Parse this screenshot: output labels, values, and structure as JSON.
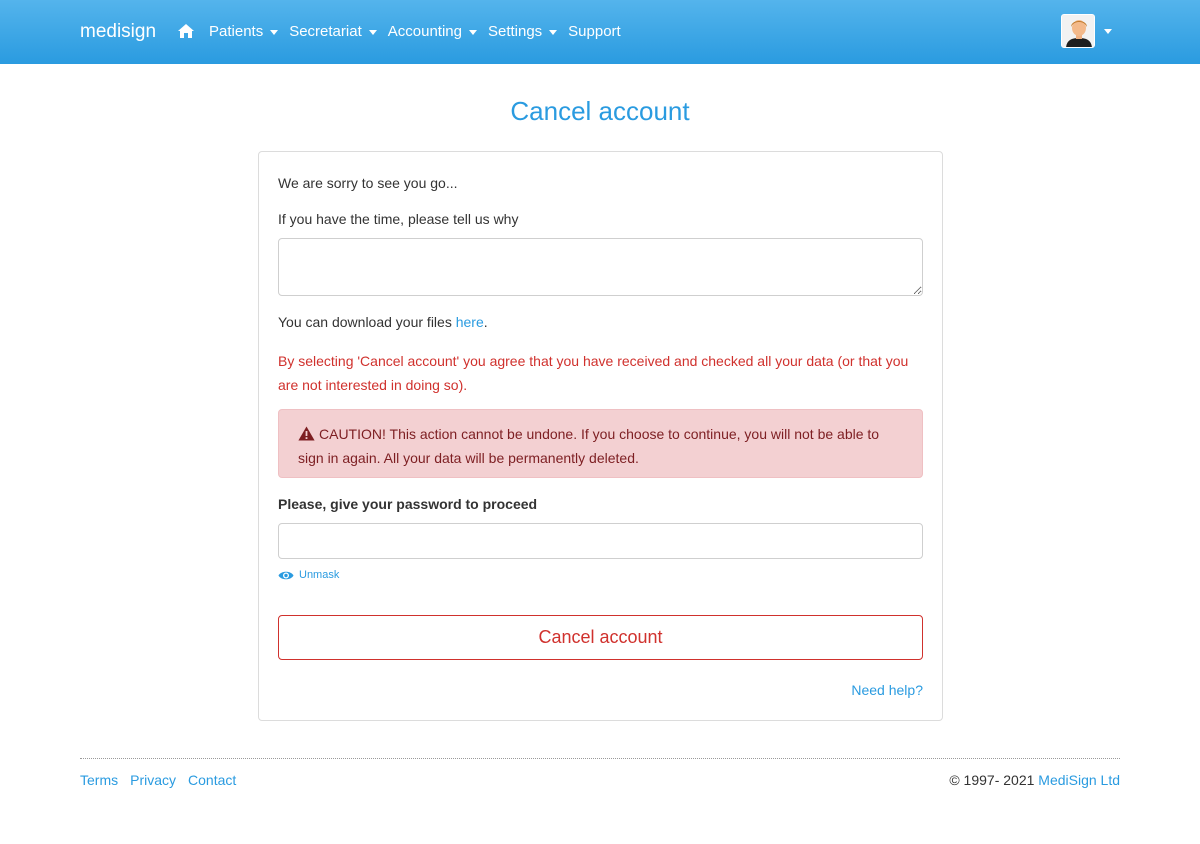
{
  "colors": {
    "accent": "#2a9be0",
    "navbar_top": "#54b4ec",
    "navbar_bottom": "#2a9be0",
    "danger": "#d0312d",
    "alert_bg": "#f3d0d2",
    "alert_text": "#7d1e22"
  },
  "navbar": {
    "brand": "medisign",
    "home_icon": "home-icon",
    "items": [
      {
        "label": "Patients",
        "has_dropdown": true
      },
      {
        "label": "Secretariat",
        "has_dropdown": true
      },
      {
        "label": "Accounting",
        "has_dropdown": true
      },
      {
        "label": "Settings",
        "has_dropdown": true
      },
      {
        "label": "Support",
        "has_dropdown": false
      }
    ],
    "avatar_icon": "user-avatar-icon"
  },
  "page": {
    "title": "Cancel account"
  },
  "form": {
    "sorry_text": "We are sorry to see you go...",
    "reason_label": "If you have the time, please tell us why",
    "reason_value": "",
    "download_text": "You can download your files ",
    "download_link": "here",
    "download_suffix": ".",
    "agreement_text": "By selecting 'Cancel account' you agree that you have received and checked all your data (or that you are not interested in doing so).",
    "caution_icon": "warning-triangle-icon",
    "caution_text": "CAUTION! This action cannot be undone. If you choose to continue, you will not be able to sign in again. All your data will be permanently deleted.",
    "password_label": "Please, give your password to proceed",
    "password_value": "",
    "unmask_icon": "eye-icon",
    "unmask_label": "Unmask",
    "cancel_button": "Cancel account",
    "help_link": "Need help?"
  },
  "footer": {
    "links": [
      "Terms",
      "Privacy",
      "Contact"
    ],
    "copyright_prefix": "© 1997- 2021 ",
    "company": "MediSign Ltd"
  }
}
